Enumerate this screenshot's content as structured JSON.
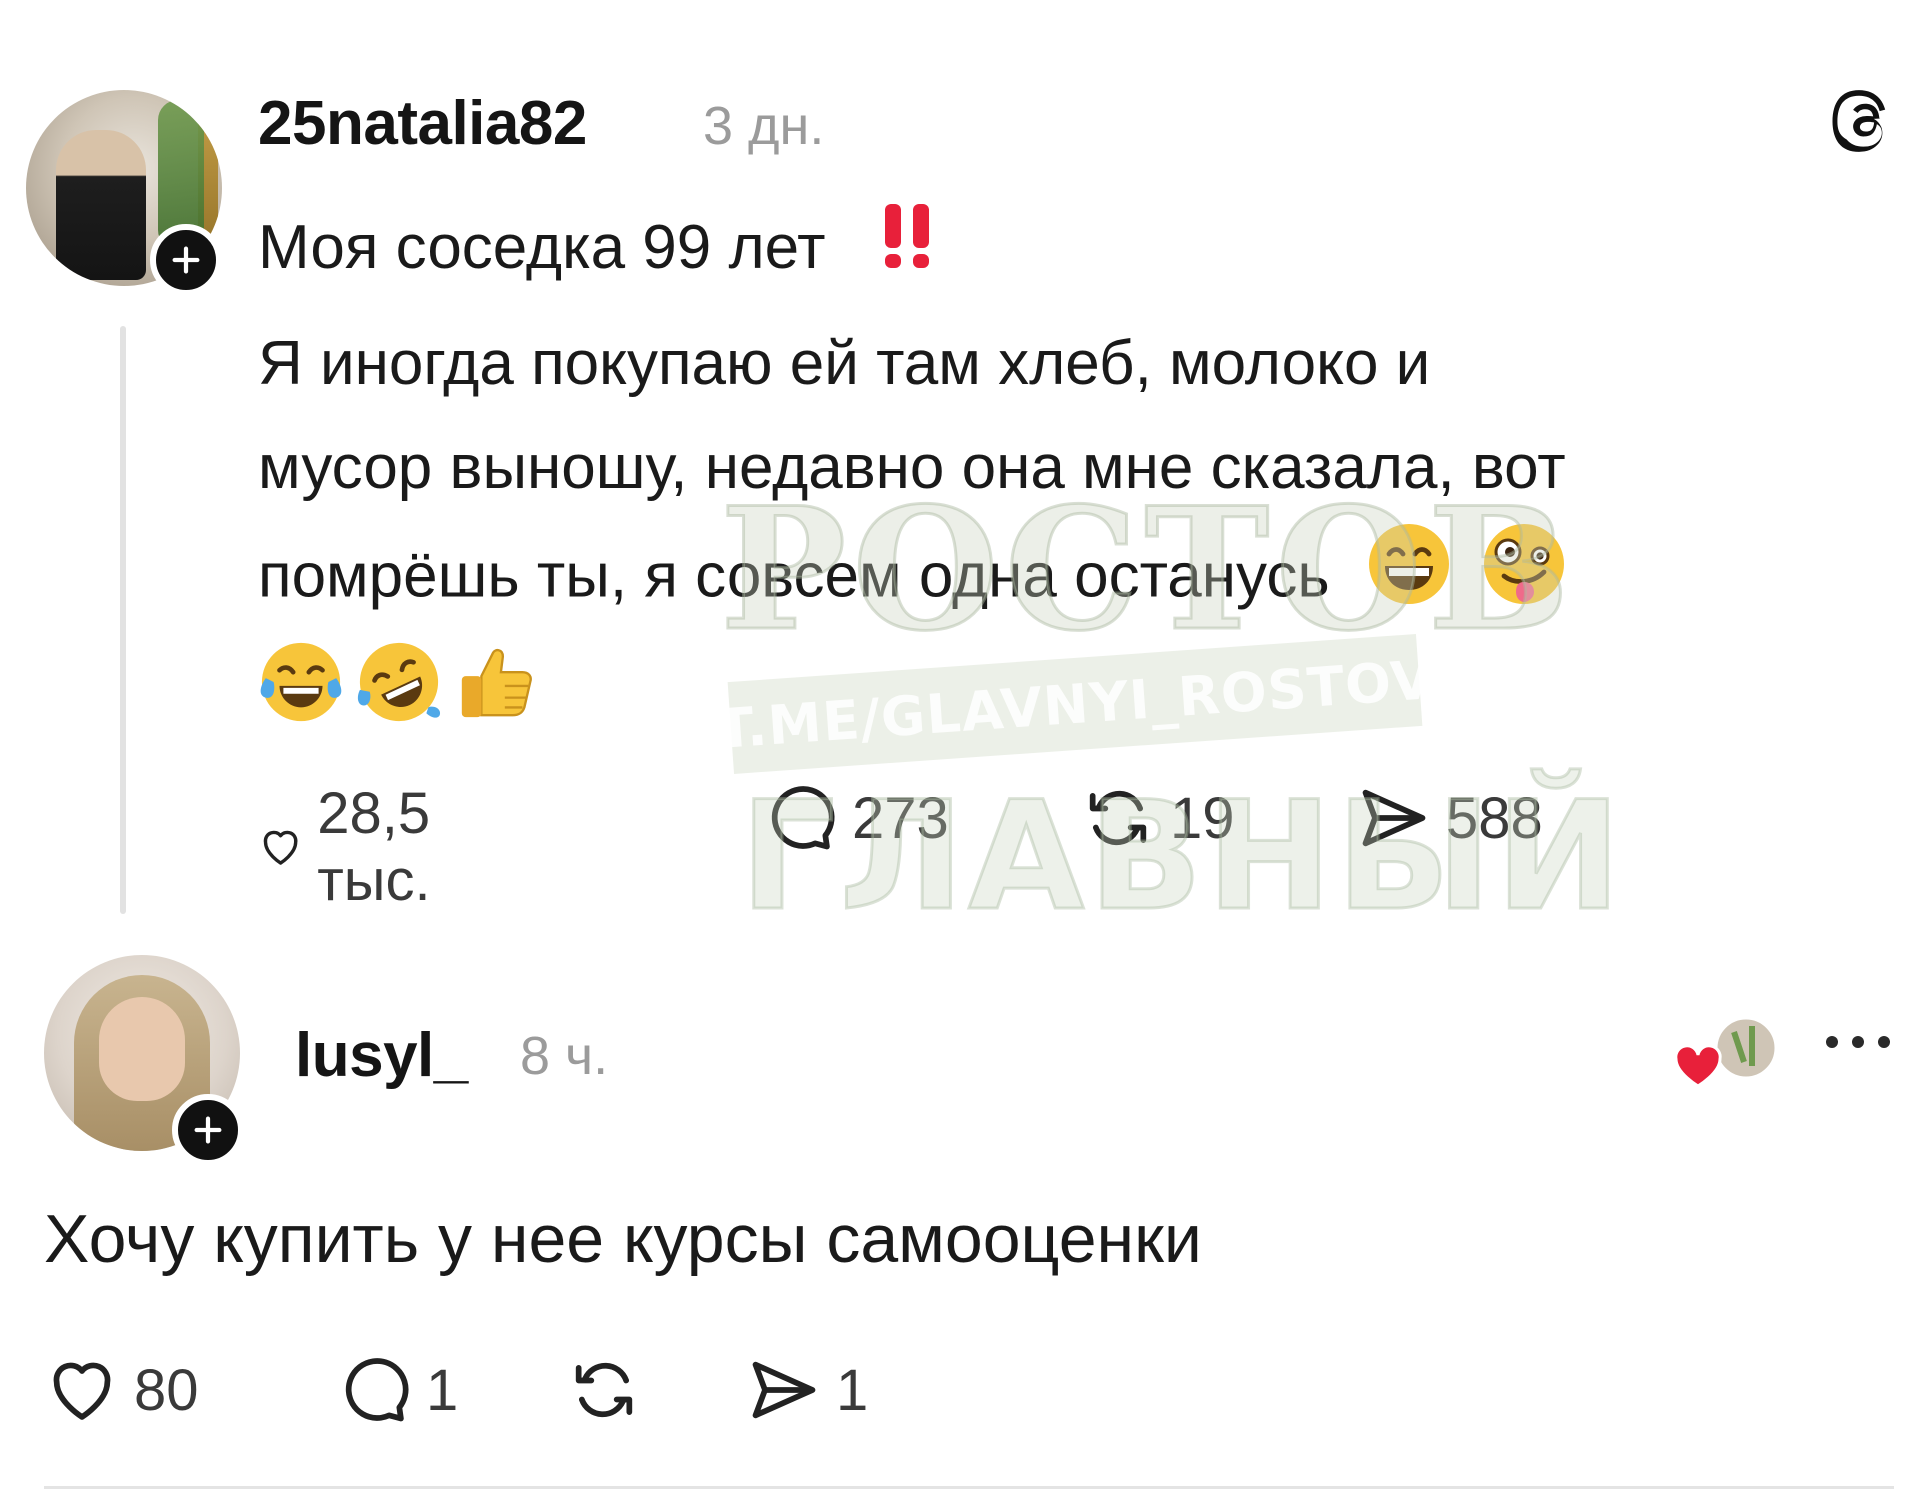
{
  "post": {
    "username": "25natalia82",
    "time": "3 дн.",
    "title_text": "Моя соседка 99 лет",
    "title_emoji": "‼️",
    "lines": [
      "Я иногда покупаю ей там хлеб, молоко и",
      "мусор выношу, недавно она мне сказала, вот",
      "помрёшь ты, я совсем одна останусь"
    ],
    "line3_emojis": [
      "😁",
      "🤪"
    ],
    "emoji_row": [
      "😂",
      "🤣",
      "👍"
    ],
    "likes": "28,5 тыс.",
    "comments": "273",
    "reposts": "19",
    "shares": "588"
  },
  "watermark": {
    "top": "РОСТОВ",
    "band": "T.ME/GLAVNYI_ROSTOV",
    "bottom": "ГЛАВНЫЙ"
  },
  "reply": {
    "username": "lusyl_",
    "time": "8 ч.",
    "text": "Хочу купить у нее курсы самооценки",
    "likes": "80",
    "comments": "1",
    "shares": "1"
  },
  "icons": {
    "plus": "plus-icon",
    "threads": "threads-logo-icon",
    "like": "heart-icon",
    "comment": "comment-icon",
    "repost": "repost-icon",
    "share": "share-icon",
    "more": "more-icon"
  },
  "colors": {
    "text": "#1a1a1a",
    "muted": "#9b9b9b",
    "heart_red": "#e8203a"
  }
}
